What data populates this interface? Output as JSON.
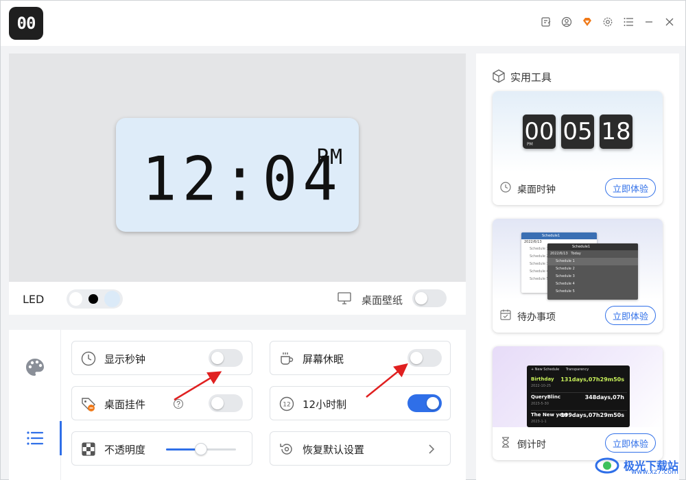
{
  "app": {
    "logo_text": "00"
  },
  "titlebar": {
    "icons": [
      "feedback-icon",
      "account-icon",
      "vip-diamond-icon",
      "settings-gear-icon",
      "menu-list-icon",
      "minimize-icon",
      "close-icon"
    ]
  },
  "preview": {
    "time": "12:04",
    "ampm": "PM"
  },
  "led_bar": {
    "label": "LED",
    "colors": [
      "#ffffff",
      "#000000",
      "#dbeaf8"
    ],
    "wallpaper_label": "桌面壁纸",
    "wallpaper_on": false
  },
  "options": {
    "show_seconds": {
      "label": "显示秒钟",
      "on": false
    },
    "screen_sleep": {
      "label": "屏幕休眠",
      "on": false
    },
    "desktop_widget": {
      "label": "桌面挂件",
      "on": false
    },
    "twelve_hour": {
      "label": "12小时制",
      "on": true
    },
    "opacity": {
      "label": "不透明度",
      "level": 0.5
    },
    "reset": {
      "label": "恢复默认设置"
    }
  },
  "tools": {
    "title": "实用工具",
    "cards": [
      {
        "name": "桌面时钟",
        "button": "立即体验",
        "digits": [
          "00",
          "05",
          "18"
        ],
        "pm": "PM"
      },
      {
        "name": "待办事项",
        "button": "立即体验",
        "back_title": "Schedule1",
        "back_date": "2022/6/13",
        "back_rows": [
          "Schedule 1",
          "Schedule 2",
          "Schedule 3",
          "Schedule 4",
          "Schedule 5"
        ],
        "front_title": "Schedule1",
        "front_date": "2022/6/13",
        "front_tag": "Today",
        "front_rows": [
          "Schedule 1",
          "Schedule 2",
          "Schedule 3",
          "Schedule 4",
          "Schedule 5"
        ]
      },
      {
        "name": "倒计时",
        "button": "立即体验",
        "cd_head": "+ New Schedule",
        "cd_transparency": "Transparency",
        "events": [
          {
            "name": "Birthday",
            "date": "2022-10-25",
            "left": "131days,07h29m50s",
            "color": "#c8f05a"
          },
          {
            "name": "QueryBlinc",
            "date": "2023-5-30",
            "left": "348days,07h",
            "color": "#ffffff"
          },
          {
            "name": "The New year",
            "date": "2023-1-1",
            "left": "199days,07h29m50s",
            "color": "#ffffff"
          }
        ]
      }
    ]
  },
  "watermark": {
    "text": "极光下载站",
    "url": "www.xz7.com"
  }
}
